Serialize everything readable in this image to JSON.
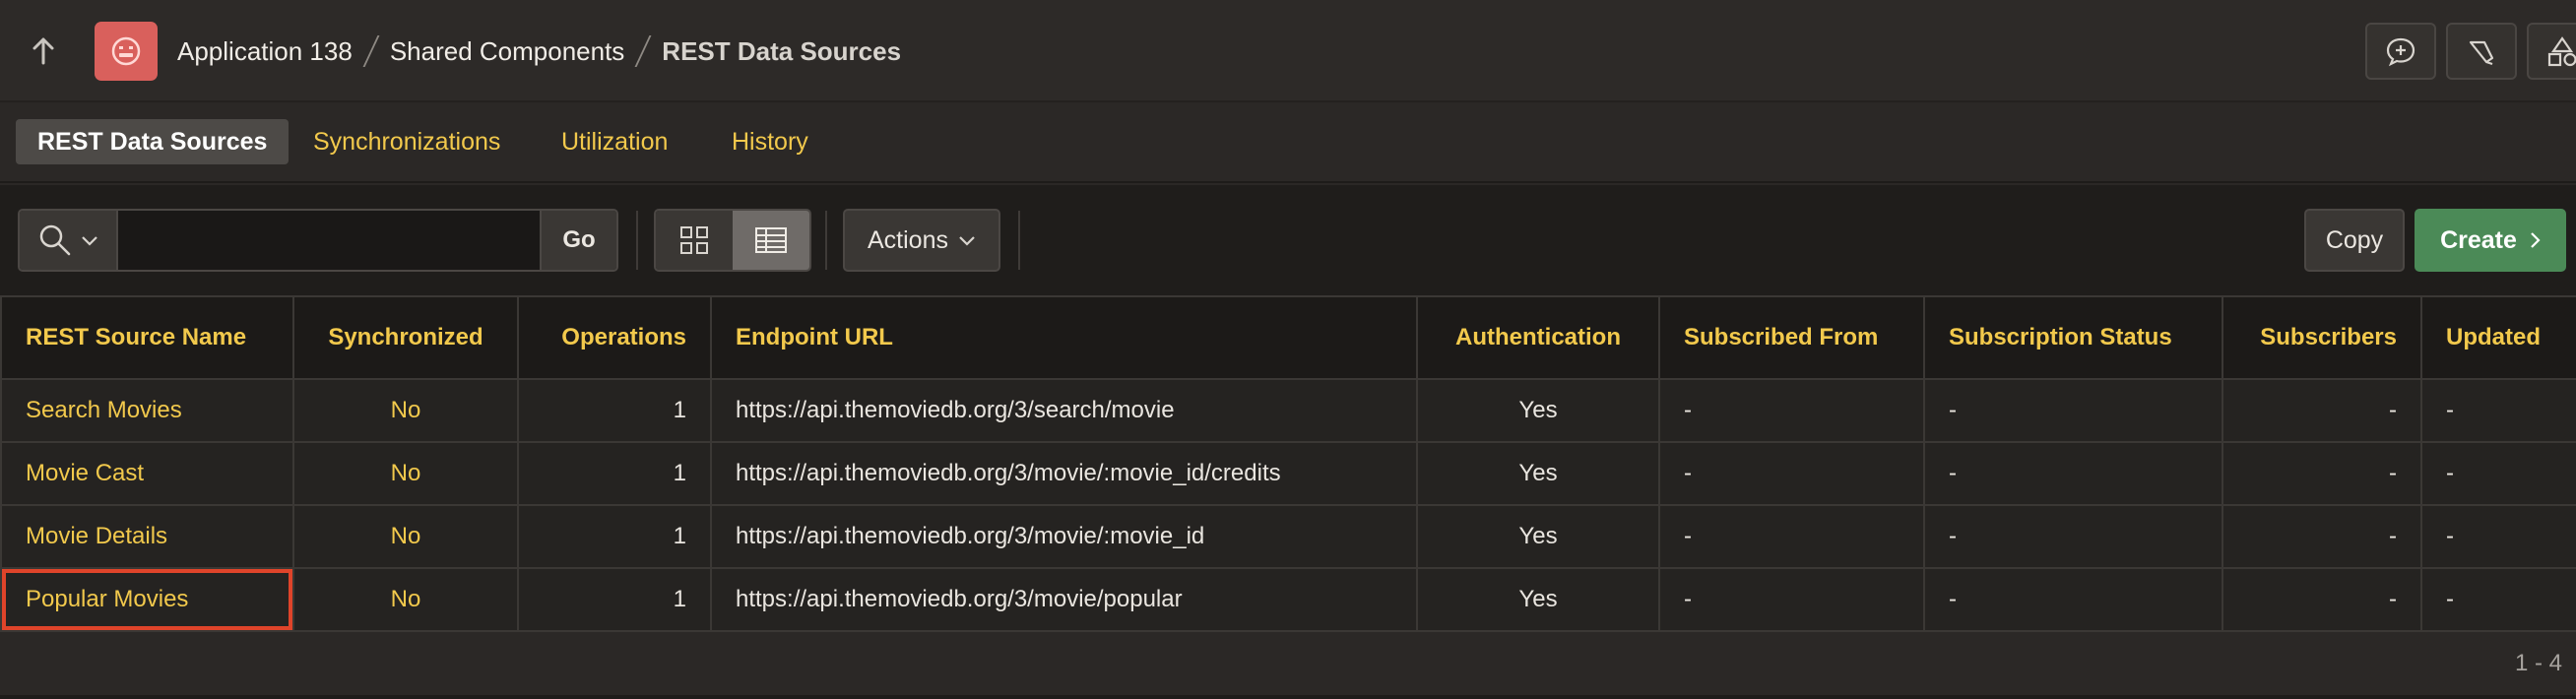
{
  "breadcrumb": {
    "items": [
      "Application 138",
      "Shared Components",
      "REST Data Sources"
    ]
  },
  "tabs": [
    {
      "label": "REST Data Sources",
      "active": true
    },
    {
      "label": "Synchronizations",
      "active": false
    },
    {
      "label": "Utilization",
      "active": false
    },
    {
      "label": "History",
      "active": false
    }
  ],
  "toolbar": {
    "search_value": "",
    "go_label": "Go",
    "actions_label": "Actions",
    "copy_label": "Copy",
    "create_label": "Create"
  },
  "table": {
    "headers": [
      "REST Source Name",
      "Synchronized",
      "Operations",
      "Endpoint URL",
      "Authentication",
      "Subscribed From",
      "Subscription Status",
      "Subscribers",
      "Updated"
    ],
    "rows": [
      {
        "name": "Search Movies",
        "synchronized": "No",
        "operations": "1",
        "endpoint": "https://api.themoviedb.org/3/search/movie",
        "authentication": "Yes",
        "subscribed_from": "-",
        "subscription_status": "-",
        "subscribers": "-",
        "updated": "-"
      },
      {
        "name": "Movie Cast",
        "synchronized": "No",
        "operations": "1",
        "endpoint": "https://api.themoviedb.org/3/movie/:movie_id/credits",
        "authentication": "Yes",
        "subscribed_from": "-",
        "subscription_status": "-",
        "subscribers": "-",
        "updated": "-"
      },
      {
        "name": "Movie Details",
        "synchronized": "No",
        "operations": "1",
        "endpoint": "https://api.themoviedb.org/3/movie/:movie_id",
        "authentication": "Yes",
        "subscribed_from": "-",
        "subscription_status": "-",
        "subscribers": "-",
        "updated": "-"
      },
      {
        "name": "Popular Movies",
        "synchronized": "No",
        "operations": "1",
        "endpoint": "https://api.themoviedb.org/3/movie/popular",
        "authentication": "Yes",
        "subscribed_from": "-",
        "subscription_status": "-",
        "subscribers": "-",
        "updated": "-"
      }
    ],
    "highlighted_row": 3,
    "pagination": "1 - 4"
  },
  "colors": {
    "accent": "#f2c94c",
    "create_button": "#4b8a57",
    "app_icon": "#d9605c",
    "highlight_border": "#e0442a"
  },
  "icons": [
    "up-arrow-icon",
    "app-icon",
    "comment-icon",
    "pen-icon",
    "shapes-icon",
    "search-icon",
    "chevron-down-icon",
    "grid-view-icon",
    "report-view-icon",
    "chevron-right-icon"
  ]
}
